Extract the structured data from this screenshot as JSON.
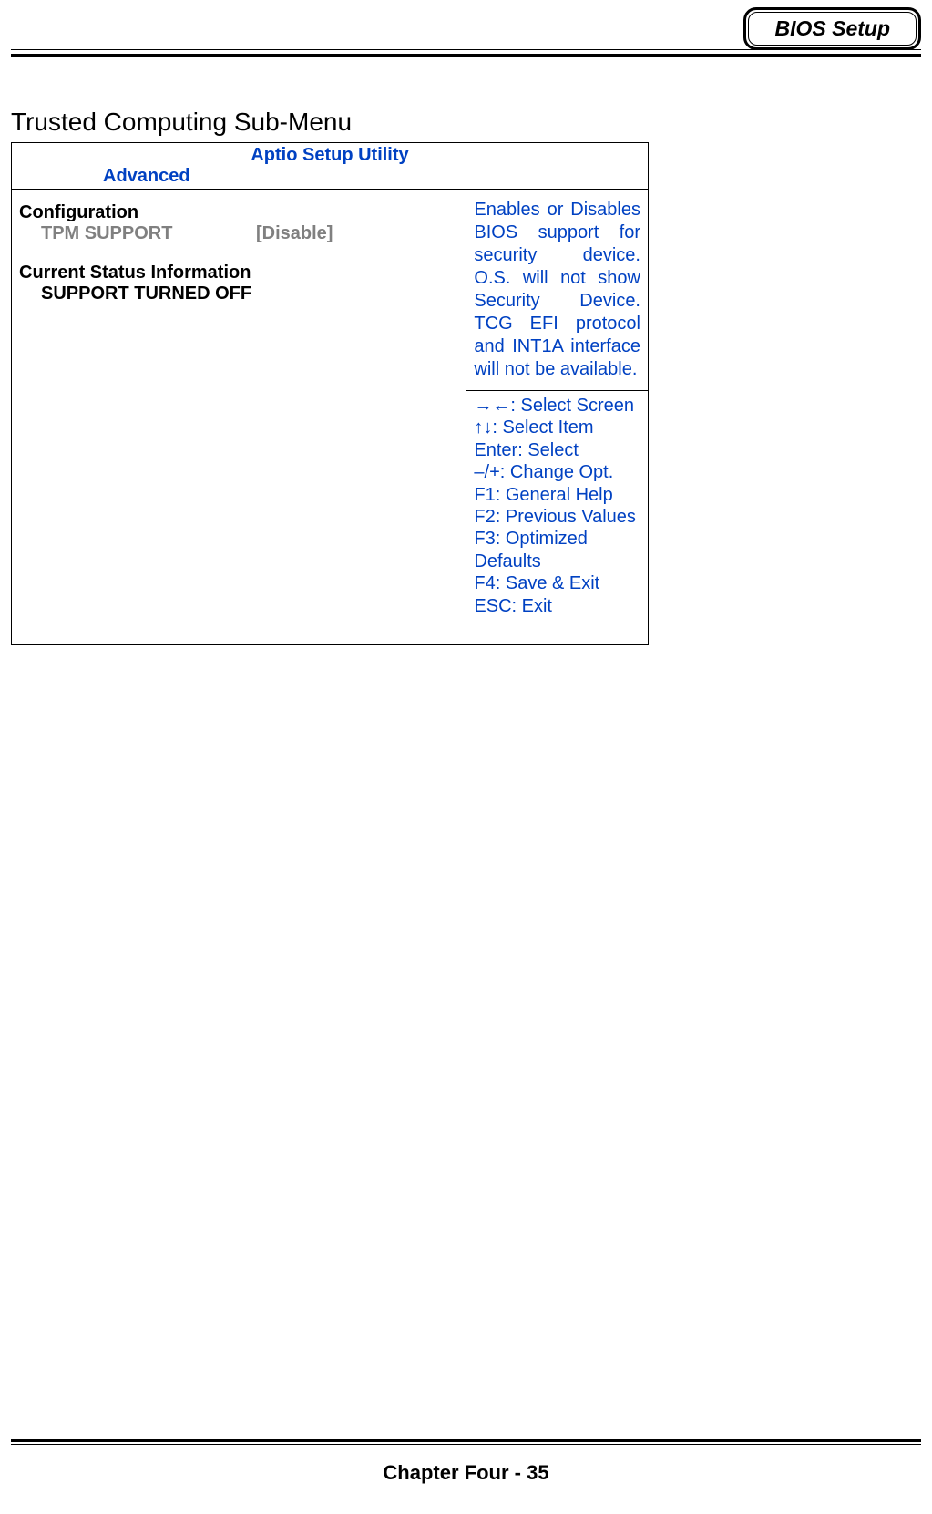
{
  "header": {
    "badge": "BIOS Setup"
  },
  "section_title": "Trusted Computing Sub-Menu",
  "bios": {
    "utility_title": "Aptio Setup Utility",
    "active_tab": "Advanced",
    "left": {
      "config_header": "Configuration",
      "tpm_label": "TPM SUPPORT",
      "tpm_value": "[Disable]",
      "status_header": "Current Status Information",
      "status_value": "SUPPORT TURNED OFF"
    },
    "help_text": "Enables or Disables BIOS support for security device. O.S. will not show Security Device. TCG EFI protocol and INT1A interface will not be available.",
    "keys": {
      "k0": "→←: Select Screen",
      "k1": "↑↓: Select Item",
      "k2": "Enter: Select",
      "k3": "–/+: Change Opt.",
      "k4": "F1: General Help",
      "k5": "F2: Previous Values",
      "k6": "F3: Optimized Defaults",
      "k7": "F4: Save & Exit",
      "k8": "ESC: Exit"
    }
  },
  "footer": "Chapter Four - 35"
}
